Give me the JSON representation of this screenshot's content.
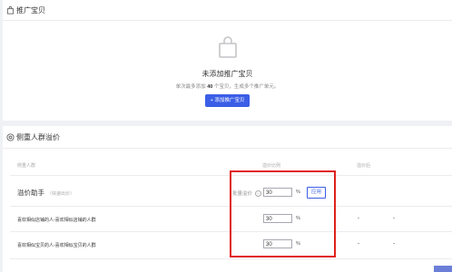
{
  "promo_panel": {
    "title": "推广宝贝",
    "empty_title": "未添加推广宝贝",
    "empty_desc_prefix": "单次最多添加",
    "empty_desc_count": "40",
    "empty_desc_suffix": "个宝贝，生成多个推广单元。",
    "add_button": "+ 添加推广宝贝"
  },
  "crowd_panel": {
    "title": "侧重人群溢价",
    "columns": [
      "侧重人群",
      "溢价比例",
      "溢价后"
    ],
    "assistant": {
      "label": "溢价助手",
      "hint": "（快速出价）",
      "batch_label": "批量溢价",
      "help_icon": "?",
      "value": "30",
      "unit": "%",
      "apply_button": "应用"
    },
    "rows": [
      {
        "label": "喜欢相似店铺的人-喜欢相似店铺的人群",
        "value": "30",
        "unit": "%",
        "after_1": "-",
        "after_2": "-"
      },
      {
        "label": "喜欢相似宝贝的人-喜欢相似宝贝的人群",
        "value": "30",
        "unit": "%",
        "after_1": "-",
        "after_2": "-"
      }
    ]
  },
  "colors": {
    "accent": "#3b5ee7",
    "highlight_box": "#e0201c"
  },
  "icons": {
    "promo_header": "shopping-bag-icon",
    "empty_state": "shopping-bag-icon",
    "crowd_header": "target-circle-icon"
  }
}
